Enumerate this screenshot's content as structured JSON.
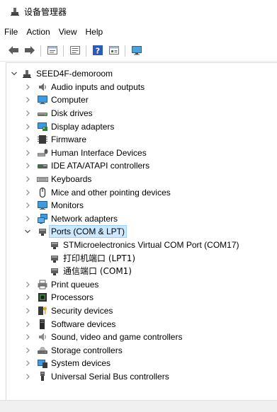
{
  "window": {
    "title": "设备管理器"
  },
  "menu": [
    {
      "label": "File"
    },
    {
      "label": "Action"
    },
    {
      "label": "View"
    },
    {
      "label": "Help"
    }
  ],
  "toolbar": [
    {
      "name": "back-button",
      "icon": "arrow-left-icon"
    },
    {
      "name": "forward-button",
      "icon": "arrow-right-icon"
    },
    {
      "name": "properties-view-button",
      "icon": "properties-icon"
    },
    {
      "name": "show-hide-tree-button",
      "icon": "tree-view-icon"
    },
    {
      "name": "help-button",
      "icon": "help-icon"
    },
    {
      "name": "details-view-button",
      "icon": "details-icon"
    },
    {
      "name": "scan-hardware-button",
      "icon": "monitor-scan-icon"
    }
  ],
  "tree": {
    "root": {
      "label": "SEED4F-demoroom",
      "icon": "computer-tree-icon",
      "expanded": true
    },
    "categories": [
      {
        "label": "Audio inputs and outputs",
        "icon": "speaker-icon"
      },
      {
        "label": "Computer",
        "icon": "monitor-icon"
      },
      {
        "label": "Disk drives",
        "icon": "disk-drive-icon"
      },
      {
        "label": "Display adapters",
        "icon": "display-adapter-icon"
      },
      {
        "label": "Firmware",
        "icon": "firmware-icon"
      },
      {
        "label": "Human Interface Devices",
        "icon": "hid-icon"
      },
      {
        "label": "IDE ATA/ATAPI controllers",
        "icon": "ide-controller-icon"
      },
      {
        "label": "Keyboards",
        "icon": "keyboard-icon"
      },
      {
        "label": "Mice and other pointing devices",
        "icon": "mouse-icon"
      },
      {
        "label": "Monitors",
        "icon": "monitor-icon"
      },
      {
        "label": "Network adapters",
        "icon": "network-adapter-icon"
      },
      {
        "label": "Ports (COM & LPT)",
        "icon": "port-icon",
        "expanded": true,
        "children": [
          {
            "label": "STMicroelectronics Virtual COM Port (COM17)",
            "icon": "port-icon"
          },
          {
            "label": "打印机端口 (LPT1)",
            "icon": "port-icon"
          },
          {
            "label": "通信端口 (COM1)",
            "icon": "port-icon"
          }
        ]
      },
      {
        "label": "Print queues",
        "icon": "printer-icon"
      },
      {
        "label": "Processors",
        "icon": "processor-icon"
      },
      {
        "label": "Security devices",
        "icon": "security-key-icon"
      },
      {
        "label": "Software devices",
        "icon": "software-device-icon"
      },
      {
        "label": "Sound, video and game controllers",
        "icon": "speaker-icon"
      },
      {
        "label": "Storage controllers",
        "icon": "storage-controller-icon"
      },
      {
        "label": "System devices",
        "icon": "system-devices-icon"
      },
      {
        "label": "Universal Serial Bus controllers",
        "icon": "usb-icon"
      }
    ]
  },
  "colors": {
    "selection_bg": "#cce8ff",
    "selection_border": "#99d1ff"
  }
}
